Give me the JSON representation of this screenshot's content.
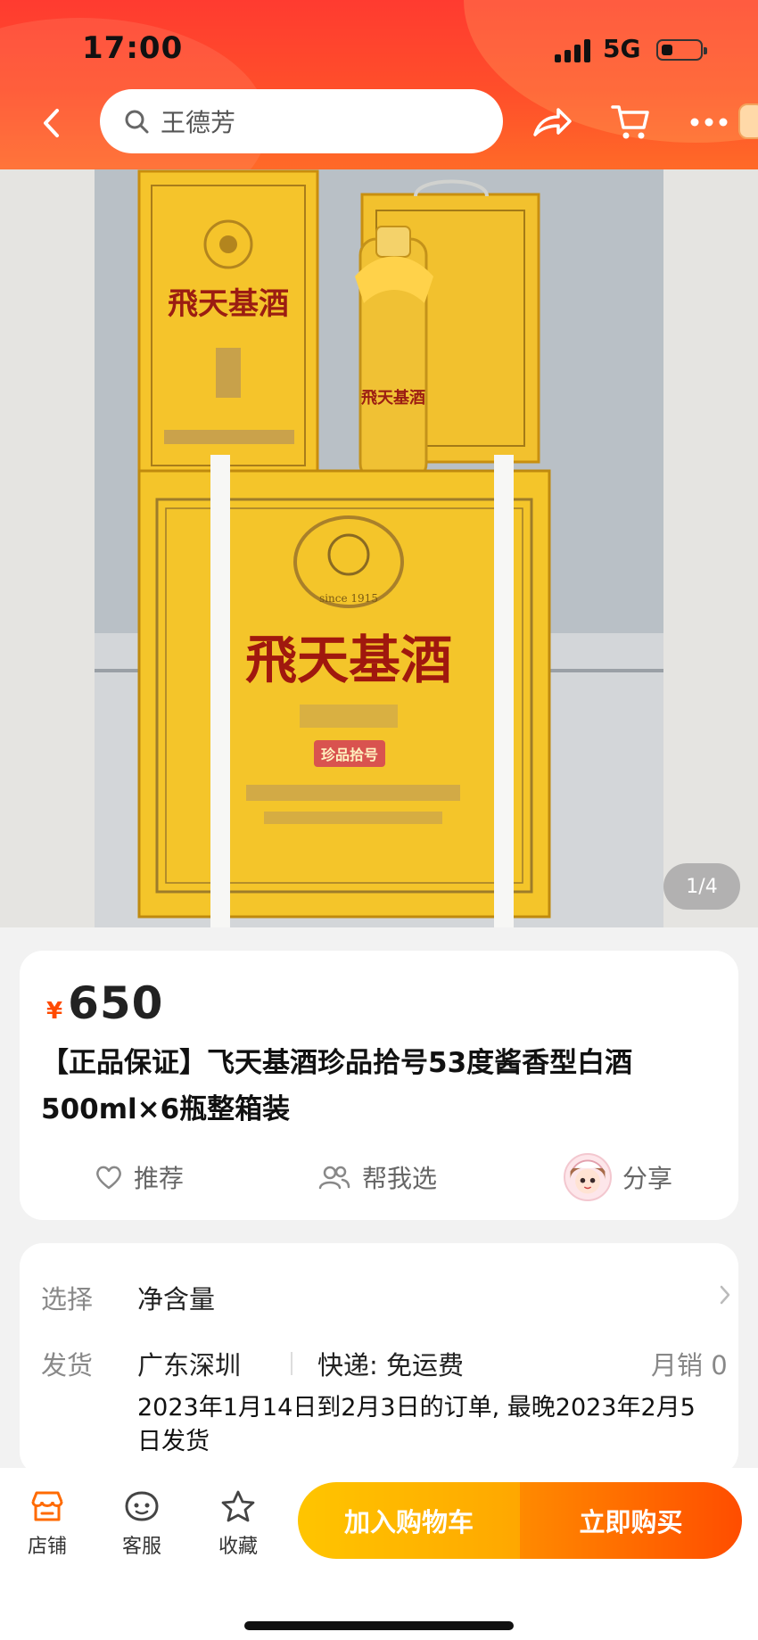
{
  "status_bar": {
    "time": "17:00",
    "network": "5G"
  },
  "header": {
    "search_placeholder": "王德芳"
  },
  "gallery": {
    "counter": "1/4",
    "brand_logo_text": "飛天基酒",
    "box_sub_text": "珍品拾号",
    "since_text": "since 1915"
  },
  "product": {
    "currency": "¥",
    "price": "650",
    "title": "【正品保证】飞天基酒珍品拾号53度酱香型白酒500ml×6瓶整箱装",
    "actions": {
      "recommend": "推荐",
      "help_choose": "帮我选",
      "share": "分享"
    }
  },
  "specs": {
    "select_label": "选择",
    "select_value": "净含量",
    "ship_label": "发货",
    "ship_from": "广东深圳",
    "express": "快递: 免运费",
    "monthly_sales": "月销 0",
    "ship_note": "2023年1月14日到2月3日的订单, 最晚2023年2月5日发货"
  },
  "bottom_bar": {
    "store": "店铺",
    "service": "客服",
    "favorite": "收藏",
    "add_to_cart": "加入购物车",
    "buy_now": "立即购买"
  },
  "colors": {
    "accent": "#ff4a00",
    "header": "#ff4f2a",
    "cart": "#ffb300",
    "buy": "#ff5a00"
  }
}
